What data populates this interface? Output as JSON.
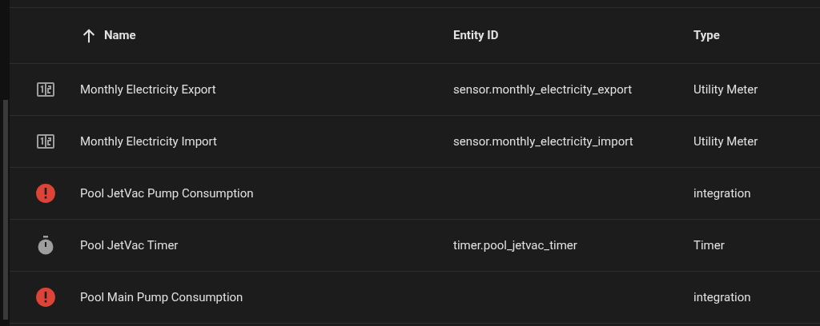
{
  "table": {
    "columns": [
      {
        "label": "Name",
        "sorted": true
      },
      {
        "label": "Entity ID",
        "sorted": false
      },
      {
        "label": "Type",
        "sorted": false
      }
    ],
    "rows": [
      {
        "kind": "meter",
        "name": "Monthly Electricity Export",
        "entity_id": "sensor.monthly_electricity_export",
        "type": "Utility Meter"
      },
      {
        "kind": "meter",
        "name": "Monthly Electricity Import",
        "entity_id": "sensor.monthly_electricity_import",
        "type": "Utility Meter"
      },
      {
        "kind": "alert",
        "name": "Pool JetVac Pump Consumption",
        "type": "integration"
      },
      {
        "kind": "timer",
        "name": "Pool JetVac Timer",
        "entity_id": "timer.pool_jetvac_timer",
        "type": "Timer"
      },
      {
        "kind": "alert",
        "name": "Pool Main Pump Consumption",
        "type": "integration"
      }
    ]
  }
}
